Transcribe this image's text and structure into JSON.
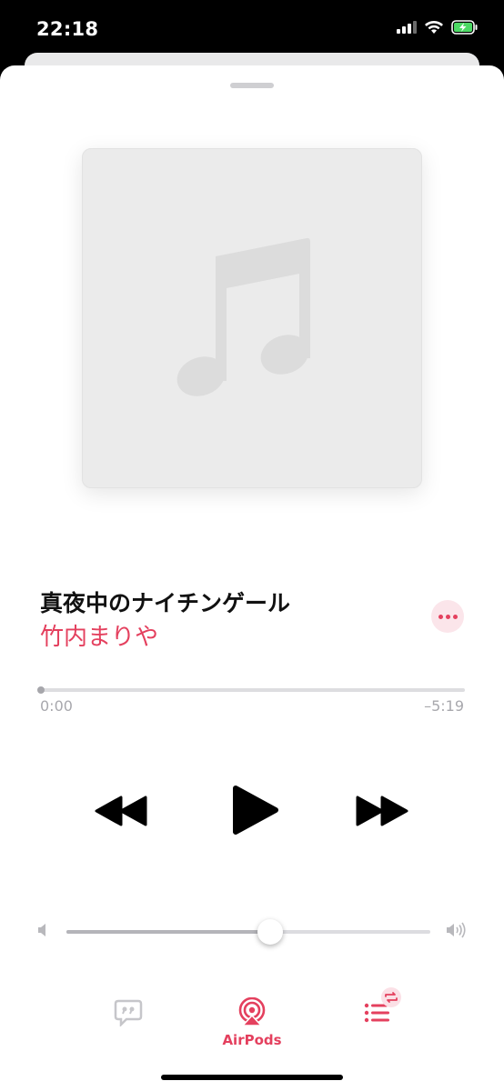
{
  "status_bar": {
    "time": "22:18",
    "icons": [
      "cellular-signal-icon",
      "wifi-icon",
      "battery-charging-icon"
    ]
  },
  "now_playing": {
    "artwork_icon": "music-note-icon",
    "title": "真夜中のナイチンゲール",
    "artist": "竹内まりや",
    "elapsed": "0:00",
    "remaining": "–5:19",
    "progress_fraction": 0.0,
    "volume_fraction": 0.56
  },
  "controls": {
    "rewind_icon": "rewind-icon",
    "play_icon": "play-icon",
    "forward_icon": "fast-forward-icon"
  },
  "bottom_bar": {
    "lyrics_icon": "lyrics-quote-icon",
    "airplay_label": "AirPods",
    "queue_icon": "queue-list-icon",
    "queue_badge_icon": "repeat-icon"
  },
  "colors": {
    "accent": "#e4405e",
    "artwork_bg": "#ebebeb"
  }
}
